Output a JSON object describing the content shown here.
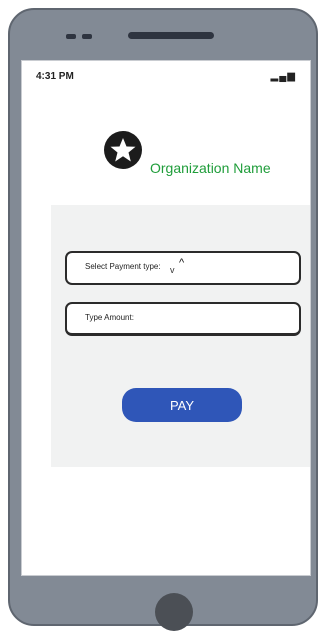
{
  "status_bar": {
    "time": "4:31 PM",
    "signal": "..."
  },
  "header": {
    "logo_icon": "star-icon",
    "organization_name": "Organization Name"
  },
  "payment_form": {
    "payment_type_label": "Select Payment type:",
    "amount_label": "Type Amount:",
    "pay_button_label": "PAY"
  },
  "colors": {
    "accent_green": "#1f9d3a",
    "pay_button_blue": "#2f56b8",
    "card_background": "#f1f2f2",
    "phone_frame": "#828a95"
  }
}
